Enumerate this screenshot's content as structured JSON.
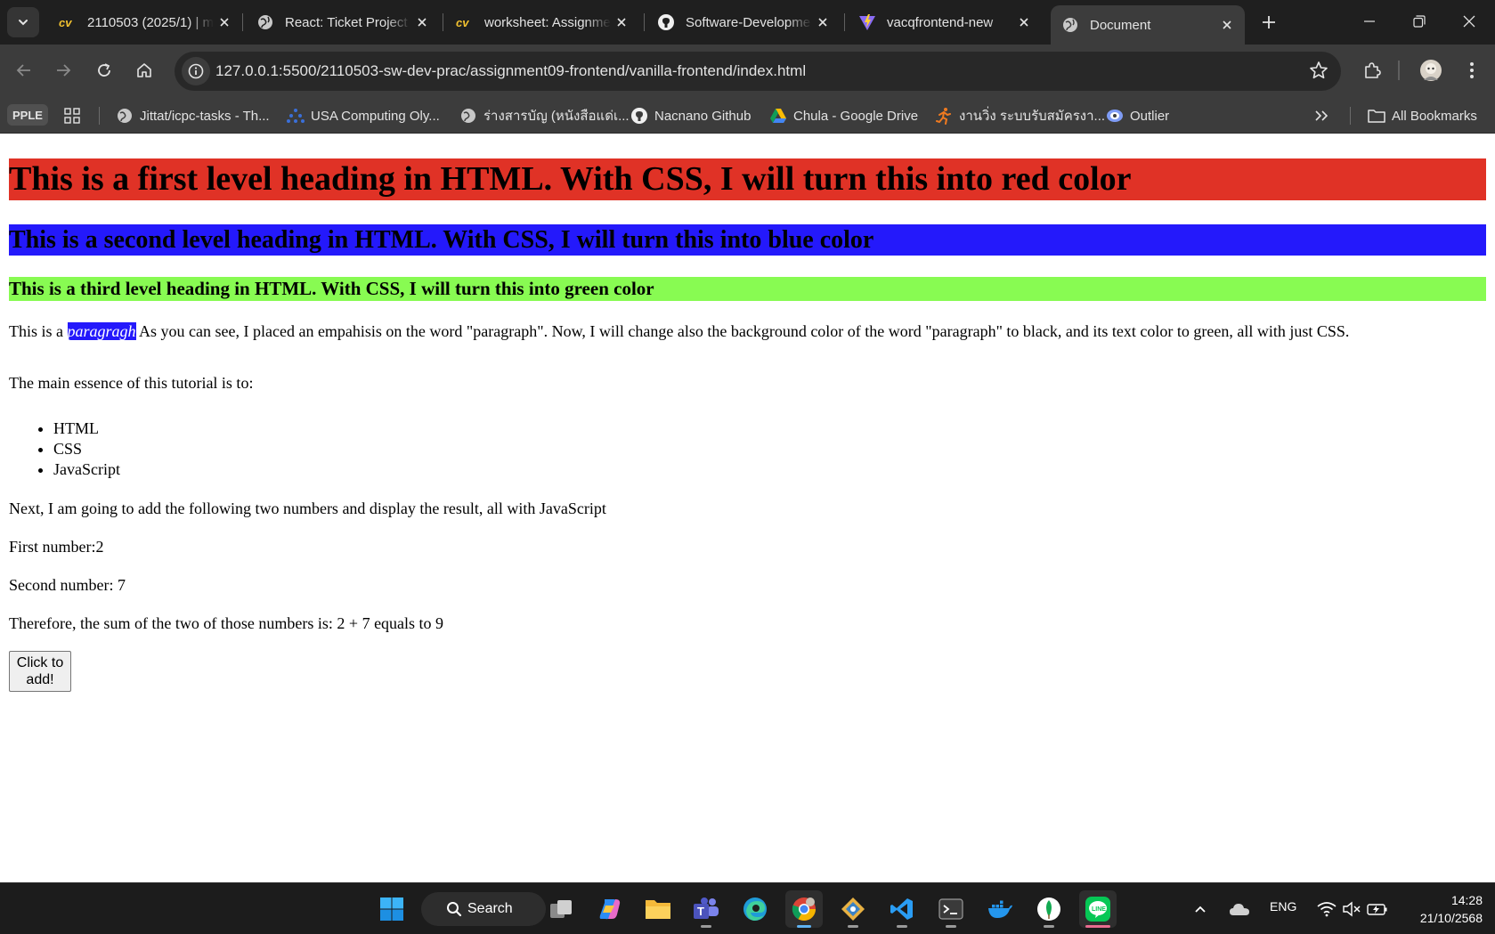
{
  "browser": {
    "tabs": [
      {
        "title": "2110503 (2025/1) | m",
        "favicon": "cv-icon",
        "active": false
      },
      {
        "title": "React: Ticket Project",
        "favicon": "globe-icon",
        "active": false
      },
      {
        "title": "worksheet: Assignme",
        "favicon": "cv-icon",
        "active": false
      },
      {
        "title": "Software-Developme",
        "favicon": "github-icon",
        "active": false
      },
      {
        "title": "vacqfrontend-new",
        "favicon": "vite-icon",
        "active": false
      },
      {
        "title": "Document",
        "favicon": "globe-icon",
        "active": true
      }
    ],
    "address": {
      "url": "127.0.0.1:5500/2110503-sw-dev-prac/assignment09-frontend/vanilla-frontend/index.html"
    },
    "bookmarks": {
      "profile_chip": "PPLE",
      "items": [
        {
          "label": "Jittat/icpc-tasks - Th...",
          "icon": "globe-icon"
        },
        {
          "label": "USA Computing Oly...",
          "icon": "usaco-icon"
        },
        {
          "label": "ร่างสารบัญ (หนังสือแด่เ...",
          "icon": "globe-icon"
        },
        {
          "label": "Nacnano Github",
          "icon": "github-icon"
        },
        {
          "label": "Chula - Google Drive",
          "icon": "drive-icon"
        },
        {
          "label": "งานวิ่ง ระบบรับสมัครงา...",
          "icon": "runner-icon"
        },
        {
          "label": "Outlier",
          "icon": "outlier-icon"
        }
      ],
      "all_bookmarks": "All Bookmarks"
    }
  },
  "page": {
    "h1": "This is a first level heading in HTML. With CSS, I will turn this into red color",
    "h2": "This is a second level heading in HTML. With CSS, I will turn this into blue color",
    "h3": "This is a third level heading in HTML. With CSS, I will turn this into green color",
    "para1_before": "This is a ",
    "para1_emph": "paragragh",
    "para1_after": " As you can see, I placed an empahisis on the word \"paragraph\". Now, I will change also the background color of the word \"paragraph\" to black, and its text color to green, all with just CSS.",
    "essence": "The main essence of this tutorial is to:",
    "list": [
      "HTML",
      "CSS",
      "JavaScript"
    ],
    "next": "Next, I am going to add the following two numbers and display the result, all with JavaScript",
    "first": "First number:2",
    "second": "Second number: 7",
    "sum": "Therefore, the sum of the two of those numbers is: 2 + 7 equals to 9",
    "button": "Click to add!"
  },
  "taskbar": {
    "search": "Search",
    "language": "ENG",
    "time": "14:28",
    "date": "21/10/2568"
  },
  "colors": {
    "h1_bg": "#e03226",
    "h2_bg": "#2419fb",
    "h3_bg": "#88fb52",
    "emphasis_bg": "#2419fb",
    "emphasis_fg": "#ffffff"
  }
}
